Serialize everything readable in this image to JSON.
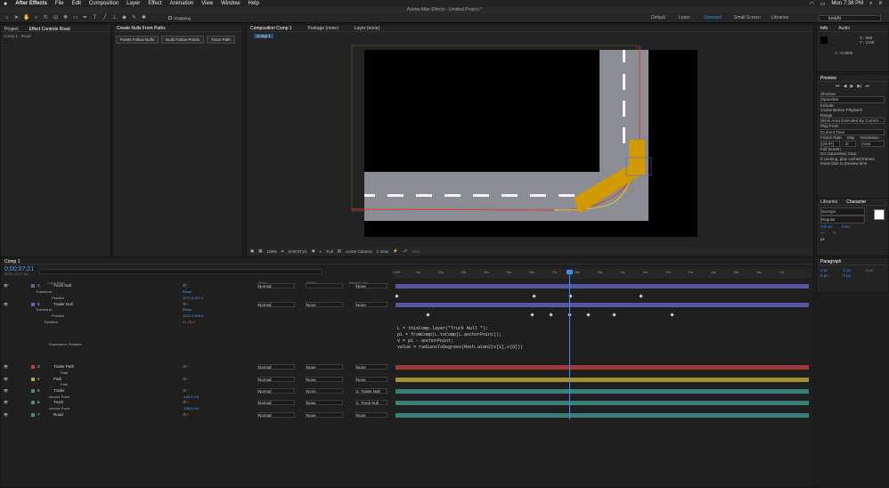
{
  "menubar": {
    "app": "After Effects",
    "items": [
      "File",
      "Edit",
      "Composition",
      "Layer",
      "Effect",
      "Animation",
      "View",
      "Window",
      "Help"
    ],
    "clock": "Mon 7:38 PM"
  },
  "titlebar": {
    "title": "Adobe After Effects - Untitled Project *"
  },
  "toolbar": {
    "snapping": "Snapping",
    "workspaces": [
      "Default",
      "Learn",
      "Standard",
      "Small Screen",
      "Libraries"
    ],
    "search": "lookAt"
  },
  "project_panel": {
    "tab_project": "Project",
    "tab_effects": "Effect Controls Road",
    "breadcrumb": "Comp 1 · Road"
  },
  "nulls_panel": {
    "title": "Create Nulls From Paths",
    "buttons": [
      "Points Follow Nulls",
      "Nulls Follow Points",
      "Trace Path"
    ]
  },
  "viewer": {
    "tab_comp": "Composition Comp 1",
    "tab_footage": "Footage (none)",
    "tab_layer": "Layer (none)",
    "comp_chip": "Comp 1",
    "zoom": "100%",
    "timecode": "0;00;07;21",
    "quality": "Full",
    "camera": "Active Camera",
    "views": "1 View",
    "exposure": "+0.0"
  },
  "info_panel": {
    "tab_info": "Info",
    "tab_audio": "Audio",
    "x": "X : 660",
    "y": "Y : 1126",
    "a": "A : 0.0000"
  },
  "preview_panel": {
    "title": "Preview",
    "shortcut_label": "Shortcut",
    "shortcut_value": "Spacebar",
    "include_label": "Include:",
    "cache_label": "Cache Before Playback",
    "range_label": "Range",
    "range_value": "Work Area Extended By Current ...",
    "playfrom_label": "Play From",
    "playfrom_value": "Current Time",
    "framerate_label": "Frame Rate",
    "skip_label": "Skip",
    "resolution_label": "Resolution",
    "framerate_value": "(29.97)",
    "skip_value": "0",
    "resolution_value": "Auto",
    "fullscreen_label": "Full Screen",
    "stop_label": "On (Spacebar) Stop:",
    "stop_opt1": "If caching, play cached frames",
    "stop_opt2": "Move time to preview time"
  },
  "character_panel": {
    "tab_libraries": "Libraries",
    "tab_character": "Character",
    "font": "Georgia",
    "style": "Regular",
    "size": "200 px",
    "leading": "Auto",
    "tracking": "0",
    "unit": "px"
  },
  "paragraph_panel": {
    "title": "Paragraph",
    "values": [
      "0 px",
      "0 px",
      "0 px",
      "0 px",
      "0 px"
    ]
  },
  "timeline": {
    "tab": "Comp 1",
    "timecode": "0;00;07;21",
    "timecode_sub": "00231 (29.97 fps)",
    "col_layer": "Layer Name",
    "col_mode": "Mode",
    "col_trkmat": "TrkMat",
    "col_parent": "Parent & Link",
    "ruler": [
      "0;00f",
      "01s",
      "02s",
      "03s",
      "04s",
      "05s",
      "06s",
      "07s",
      "08s",
      "09s",
      "10s",
      "11s",
      "12s",
      "13s",
      "14s",
      "15s",
      "16s",
      "17s"
    ],
    "layers": [
      {
        "num": "1",
        "name": "Truck Null",
        "mode": "Normal",
        "trk": "",
        "parent": "None",
        "color": "#5e62b8"
      },
      {
        "num": "2",
        "name": "Trailer Null",
        "mode": "Normal",
        "trk": "None",
        "parent": "None",
        "color": "#5e62b8"
      },
      {
        "num": "3",
        "name": "Trailer Path",
        "mode": "Normal",
        "trk": "None",
        "parent": "None",
        "color": "#b83d3d"
      },
      {
        "num": "4",
        "name": "Path",
        "mode": "Normal",
        "trk": "None",
        "parent": "None",
        "color": "#b8a43a"
      },
      {
        "num": "5",
        "name": "Trailer",
        "mode": "Normal",
        "trk": "None",
        "parent": "2. Trailer Null",
        "color": "#3e8f89"
      },
      {
        "num": "6",
        "name": "Truck",
        "mode": "Normal",
        "trk": "None",
        "parent": "1. Truck Null",
        "color": "#3e8f89"
      },
      {
        "num": "7",
        "name": "Road",
        "mode": "Normal",
        "trk": "None",
        "parent": "None",
        "color": "#3e8f89"
      }
    ],
    "props": {
      "transform": "Transform",
      "reset": "Reset",
      "position": "Position",
      "truck_pos": "1172.0,707.1",
      "trailer_pos": "1272.0,878.6",
      "rotation": "Rotation",
      "rotation_val": "0x-25.1°",
      "expression_label": "Expression: Rotation",
      "path": "Path",
      "anchor": "Anchor Point",
      "trailer_anchor": "-140.0,0.0",
      "truck_anchor": "-128.0,0.0"
    },
    "expression": "L = thisComp.layer(\"Truck Null \");\np1 = fromComp(L.toComp(L.anchorPoint));\nv = p1 - anchorPoint;\nvalue = radiansToDegrees(Math.atan2(v[1],v[0]))"
  },
  "colors": {
    "playhead": "#3d8ef0",
    "path_red": "#e03a2a",
    "path_yellow": "#e8d21f",
    "truck": "#d09a00",
    "road": "#8b8c94"
  }
}
